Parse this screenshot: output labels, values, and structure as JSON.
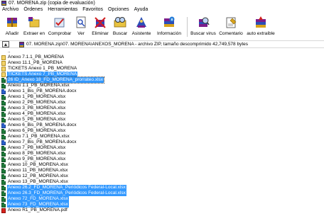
{
  "window": {
    "title": "07. MORENA.zip (copia de evaluación)"
  },
  "menu": [
    "Archivo",
    "Órdenes",
    "Herramientas",
    "Favoritos",
    "Opciones",
    "Ayuda"
  ],
  "toolbar": [
    {
      "label": "Añadir",
      "icon": "add-archive-icon"
    },
    {
      "label": "Extraer en",
      "icon": "extract-icon"
    },
    {
      "label": "Comprobar",
      "icon": "test-icon"
    },
    {
      "label": "Ver",
      "icon": "view-icon"
    },
    {
      "label": "Eliminar",
      "icon": "delete-icon"
    },
    {
      "label": "Buscar",
      "icon": "find-icon"
    },
    {
      "label": "Asistente",
      "icon": "wizard-icon"
    },
    {
      "label": "Información",
      "icon": "info-icon"
    },
    {
      "label": "Buscar virus",
      "icon": "virus-scan-icon"
    },
    {
      "label": "Comentario",
      "icon": "comment-icon"
    },
    {
      "label": "auto extraíble",
      "icon": "sfx-icon"
    }
  ],
  "address": {
    "path": "07. MORENA.zip\\07. MORENA\\ANEXOS_MORENA - archivo ZIP, tamaño descomprimido 42,749,578 bytes"
  },
  "files": [
    {
      "name": "..",
      "type": "none",
      "selected": false
    },
    {
      "name": "Anexo 7.1.1_PB_MORENA",
      "type": "folder",
      "selected": false
    },
    {
      "name": "Anexo 11.1_PB_MORENA",
      "type": "folder",
      "selected": false
    },
    {
      "name": "TICKETS Anexo 1_PB_MORENA",
      "type": "folder",
      "selected": false
    },
    {
      "name": "TICKETS Anexo 7_PB_MORENA",
      "type": "folder",
      "selected": true
    },
    {
      "name": "26 ID_Anexo 18_FD_MORENA_prorrateo.xlsx",
      "type": "xlsx",
      "selected": true
    },
    {
      "name": "Anexo 1.1_PB_MORENA.xlsx",
      "type": "xlsx",
      "selected": false
    },
    {
      "name": "Anexo 1_Bis_PB_MORENA.docx",
      "type": "docx",
      "selected": false
    },
    {
      "name": "Anexo 1_PB_MORENA.xlsx",
      "type": "xlsx",
      "selected": false
    },
    {
      "name": "Anexo 2_PB_MORENA.xlsx",
      "type": "xlsx",
      "selected": false
    },
    {
      "name": "Anexo 3_PB_MORENA.xlsx",
      "type": "xlsx",
      "selected": false
    },
    {
      "name": "Anexo 4_PB_MORENA.xlsx",
      "type": "xlsx",
      "selected": false
    },
    {
      "name": "Anexo 5_PB_MORENA.xlsx",
      "type": "xlsx",
      "selected": false
    },
    {
      "name": "Anexo 6_Bis_PB_MORENA.docx",
      "type": "docx",
      "selected": false
    },
    {
      "name": "Anexo 6_PB_MORENA.xlsx",
      "type": "xlsx",
      "selected": false
    },
    {
      "name": "Anexo 7.1_PB_MORENA.xlsx",
      "type": "xlsx",
      "selected": false
    },
    {
      "name": "Anexo 7_Bis_PB_MORENA.docx",
      "type": "docx",
      "selected": false
    },
    {
      "name": "Anexo 7_PB_MORENA.xlsx",
      "type": "xlsx",
      "selected": false
    },
    {
      "name": "Anexo 8_PB_MORENA.xlsx",
      "type": "xlsx",
      "selected": false
    },
    {
      "name": "Anexo 9_PB_MORENA.xlsx",
      "type": "xlsx",
      "selected": false
    },
    {
      "name": "Anexo 10_PB_MORENA.xlsx",
      "type": "xlsx",
      "selected": false
    },
    {
      "name": "Anexo 11_PB_MORENA.xlsx",
      "type": "xlsx",
      "selected": false
    },
    {
      "name": "Anexo 12_PB_MORENA.xlsx",
      "type": "xlsx",
      "selected": false
    },
    {
      "name": "Anexo 13_PB_MORENA.xlsx",
      "type": "xlsx",
      "selected": false
    },
    {
      "name": "Anexo 26.2_FD_MORENA_Periódicos Federal-Local.xlsx",
      "type": "xlsx",
      "selected": true
    },
    {
      "name": "Anexo 26.3_FD_MORENA_Periódicos Federal-Local.xlsx",
      "type": "xlsx",
      "selected": true
    },
    {
      "name": "Anexo 72_FD_MORENA.xlsx",
      "type": "xlsx",
      "selected": true
    },
    {
      "name": "Anexo 73_FD_MORENA.xlsx",
      "type": "xlsx",
      "selected": true
    },
    {
      "name": "Anexo R1_PB_MORENA.pdf",
      "type": "pdf",
      "selected": false
    }
  ]
}
